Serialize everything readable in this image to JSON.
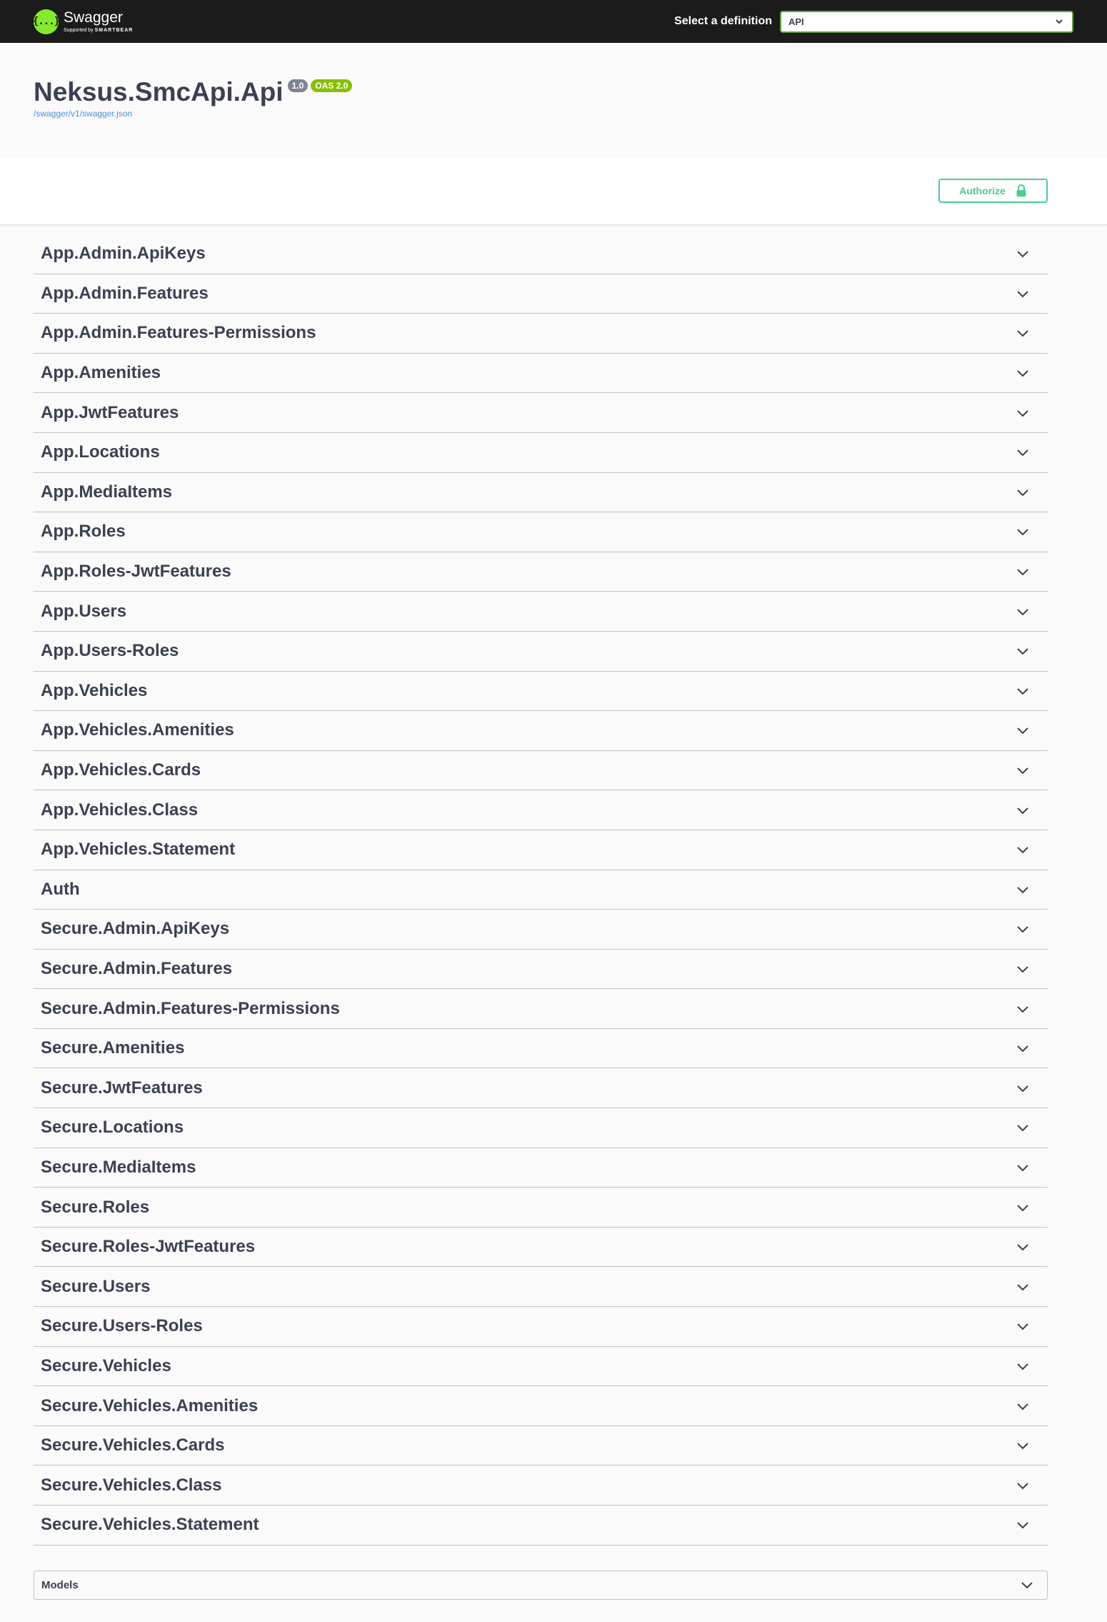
{
  "topbar": {
    "brand_name": "Swagger",
    "brand_sub_prefix": "Supported by",
    "brand_sub_name": "SMARTBEAR",
    "logo_glyph": "{...}",
    "logo_color": "#85ea2d",
    "definition_label": "Select a definition",
    "definition_value": "API"
  },
  "info": {
    "title": "Neksus.SmcApi.Api",
    "version": "1.0",
    "oas": "OAS 2.0",
    "spec_link": "/swagger/v1/swagger.json"
  },
  "auth": {
    "authorize_label": "Authorize",
    "accent_color": "#49cc90"
  },
  "tags": [
    {
      "name": "App.Admin.ApiKeys"
    },
    {
      "name": "App.Admin.Features"
    },
    {
      "name": "App.Admin.Features-Permissions"
    },
    {
      "name": "App.Amenities"
    },
    {
      "name": "App.JwtFeatures"
    },
    {
      "name": "App.Locations"
    },
    {
      "name": "App.MediaItems"
    },
    {
      "name": "App.Roles"
    },
    {
      "name": "App.Roles-JwtFeatures"
    },
    {
      "name": "App.Users"
    },
    {
      "name": "App.Users-Roles"
    },
    {
      "name": "App.Vehicles"
    },
    {
      "name": "App.Vehicles.Amenities"
    },
    {
      "name": "App.Vehicles.Cards"
    },
    {
      "name": "App.Vehicles.Class"
    },
    {
      "name": "App.Vehicles.Statement"
    },
    {
      "name": "Auth"
    },
    {
      "name": "Secure.Admin.ApiKeys"
    },
    {
      "name": "Secure.Admin.Features"
    },
    {
      "name": "Secure.Admin.Features-Permissions"
    },
    {
      "name": "Secure.Amenities"
    },
    {
      "name": "Secure.JwtFeatures"
    },
    {
      "name": "Secure.Locations"
    },
    {
      "name": "Secure.MediaItems"
    },
    {
      "name": "Secure.Roles"
    },
    {
      "name": "Secure.Roles-JwtFeatures"
    },
    {
      "name": "Secure.Users"
    },
    {
      "name": "Secure.Users-Roles"
    },
    {
      "name": "Secure.Vehicles"
    },
    {
      "name": "Secure.Vehicles.Amenities"
    },
    {
      "name": "Secure.Vehicles.Cards"
    },
    {
      "name": "Secure.Vehicles.Class"
    },
    {
      "name": "Secure.Vehicles.Statement"
    }
  ],
  "models": {
    "title": "Models"
  }
}
